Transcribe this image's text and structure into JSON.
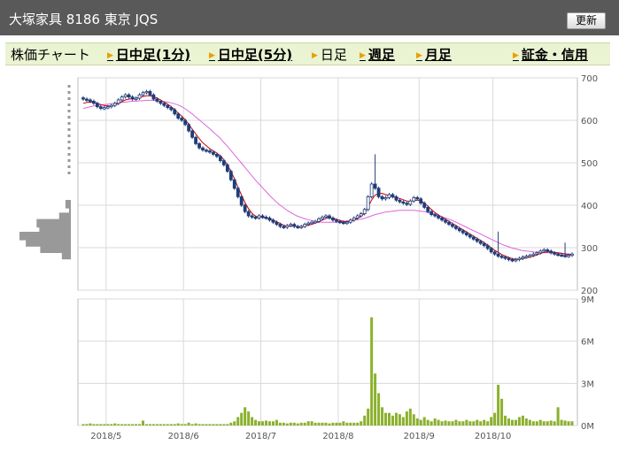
{
  "header": {
    "title": "大塚家具  8186  東京 JQS",
    "refresh_label": "更新"
  },
  "menu": {
    "items": [
      {
        "label": "株価チャート",
        "link": false,
        "arrow": false
      },
      {
        "label": "日中足(1分)",
        "link": true,
        "arrow": true
      },
      {
        "label": "日中足(5分)",
        "link": true,
        "arrow": true
      },
      {
        "label": "日足",
        "link": false,
        "arrow": true
      },
      {
        "label": "週足",
        "link": true,
        "arrow": true
      },
      {
        "label": "月足",
        "link": true,
        "arrow": true
      },
      {
        "label": "証金・信用",
        "link": true,
        "arrow": true
      }
    ]
  },
  "chart_data": [
    {
      "type": "candlestick",
      "title": "",
      "ylim": [
        200,
        700
      ],
      "yticks": [
        200,
        300,
        400,
        500,
        600,
        700
      ],
      "x_labels": [
        "2018/5",
        "2018/6",
        "2018/7",
        "2018/8",
        "2018/9",
        "2018/10"
      ],
      "grid": true,
      "colors": {
        "candle": "#1f3d7a",
        "ma_short": "#cc0000",
        "ma_long": "#dd66dd",
        "volume_profile": "#999999",
        "grid": "#d9d9d9"
      },
      "close_series": [
        650,
        648,
        645,
        640,
        632,
        628,
        630,
        632,
        635,
        640,
        648,
        655,
        660,
        655,
        650,
        652,
        660,
        665,
        668,
        660,
        650,
        645,
        640,
        635,
        630,
        625,
        615,
        605,
        600,
        590,
        575,
        560,
        545,
        535,
        530,
        528,
        525,
        520,
        515,
        505,
        495,
        480,
        460,
        440,
        420,
        400,
        385,
        375,
        372,
        370,
        375,
        372,
        370,
        365,
        360,
        355,
        350,
        348,
        352,
        355,
        350,
        348,
        350,
        355,
        358,
        360,
        362,
        368,
        372,
        375,
        370,
        365,
        362,
        360,
        358,
        360,
        365,
        370,
        375,
        380,
        390,
        420,
        450,
        440,
        420,
        415,
        418,
        425,
        420,
        412,
        408,
        405,
        402,
        410,
        418,
        415,
        405,
        395,
        385,
        378,
        375,
        370,
        365,
        360,
        355,
        350,
        345,
        340,
        335,
        330,
        325,
        320,
        315,
        310,
        305,
        298,
        290,
        285,
        280,
        278,
        275,
        272,
        270,
        272,
        275,
        278,
        280,
        282,
        285,
        288,
        292,
        295,
        292,
        288,
        285,
        283,
        282,
        280,
        282,
        285
      ],
      "ma_short": [
        640,
        642,
        643,
        642,
        640,
        637,
        635,
        634,
        634,
        636,
        639,
        644,
        648,
        650,
        651,
        652,
        654,
        656,
        658,
        658,
        656,
        652,
        648,
        643,
        638,
        632,
        625,
        617,
        610,
        601,
        591,
        579,
        568,
        557,
        547,
        540,
        533,
        528,
        523,
        516,
        507,
        495,
        480,
        462,
        443,
        424,
        406,
        392,
        381,
        374,
        372,
        371,
        370,
        368,
        365,
        361,
        357,
        353,
        351,
        351,
        351,
        350,
        350,
        351,
        353,
        355,
        358,
        361,
        365,
        369,
        370,
        369,
        367,
        364,
        362,
        361,
        362,
        365,
        369,
        374,
        381,
        396,
        412,
        424,
        428,
        428,
        425,
        422,
        420,
        418,
        416,
        413,
        410,
        409,
        411,
        412,
        410,
        405,
        398,
        390,
        383,
        377,
        372,
        367,
        362,
        357,
        352,
        347,
        342,
        337,
        332,
        327,
        322,
        317,
        312,
        306,
        300,
        294,
        289,
        284,
        280,
        277,
        274,
        273,
        273,
        274,
        276,
        278,
        280,
        283,
        286,
        289,
        290,
        290,
        289,
        288,
        287,
        285,
        284,
        284
      ],
      "ma_long": [
        628,
        630,
        632,
        634,
        635,
        636,
        637,
        638,
        639,
        640,
        641,
        642,
        643,
        644,
        645,
        645,
        646,
        646,
        647,
        647,
        647,
        646,
        645,
        644,
        643,
        641,
        639,
        636,
        632,
        627,
        621,
        615,
        608,
        601,
        594,
        587,
        580,
        572,
        565,
        557,
        548,
        539,
        529,
        519,
        509,
        499,
        489,
        479,
        469,
        459,
        450,
        441,
        432,
        423,
        415,
        407,
        400,
        394,
        388,
        383,
        378,
        374,
        371,
        368,
        366,
        364,
        362,
        361,
        360,
        360,
        360,
        360,
        360,
        361,
        362,
        363,
        364,
        365,
        366,
        367,
        369,
        372,
        375,
        378,
        380,
        382,
        384,
        385,
        386,
        387,
        388,
        388,
        388,
        388,
        388,
        387,
        386,
        385,
        383,
        381,
        379,
        376,
        373,
        370,
        367,
        364,
        360,
        356,
        352,
        348,
        344,
        340,
        336,
        332,
        328,
        324,
        320,
        316,
        312,
        308,
        305,
        302,
        299,
        297,
        295,
        293,
        292,
        291,
        290,
        289,
        289,
        288,
        288,
        288,
        287,
        287,
        286,
        286,
        285,
        285
      ],
      "spikes": [
        {
          "index": 83,
          "high": 520
        },
        {
          "index": 118,
          "high": 338
        },
        {
          "index": 137,
          "high": 312
        }
      ],
      "volume_profile": [
        6,
        2,
        13,
        38,
        35,
        57,
        50,
        34,
        10
      ]
    },
    {
      "type": "bar",
      "title": "",
      "ylim": [
        0,
        9
      ],
      "yticks": [
        0,
        3,
        6,
        9
      ],
      "ytick_labels": [
        "0M",
        "3M",
        "6M",
        "9M"
      ],
      "x_labels": [
        "2018/5",
        "2018/6",
        "2018/7",
        "2018/8",
        "2018/9",
        "2018/10"
      ],
      "grid": true,
      "colors": {
        "bar": "#8bb12d"
      },
      "values": [
        0.1,
        0.1,
        0.15,
        0.1,
        0.1,
        0.1,
        0.1,
        0.1,
        0.1,
        0.15,
        0.1,
        0.1,
        0.1,
        0.1,
        0.1,
        0.1,
        0.1,
        0.35,
        0.1,
        0.1,
        0.1,
        0.1,
        0.1,
        0.1,
        0.1,
        0.1,
        0.1,
        0.15,
        0.1,
        0.1,
        0.2,
        0.1,
        0.15,
        0.1,
        0.1,
        0.1,
        0.1,
        0.1,
        0.1,
        0.1,
        0.1,
        0.1,
        0.2,
        0.3,
        0.6,
        0.9,
        1.3,
        1.0,
        0.6,
        0.4,
        0.3,
        0.3,
        0.35,
        0.3,
        0.3,
        0.4,
        0.2,
        0.2,
        0.15,
        0.2,
        0.2,
        0.15,
        0.2,
        0.2,
        0.3,
        0.3,
        0.2,
        0.2,
        0.2,
        0.2,
        0.15,
        0.2,
        0.2,
        0.2,
        0.3,
        0.2,
        0.2,
        0.2,
        0.2,
        0.3,
        0.7,
        1.2,
        7.7,
        3.7,
        2.3,
        1.3,
        0.9,
        0.9,
        0.7,
        0.9,
        0.8,
        0.6,
        1.0,
        1.2,
        0.8,
        0.5,
        0.4,
        0.6,
        0.4,
        0.3,
        0.5,
        0.4,
        0.3,
        0.35,
        0.3,
        0.3,
        0.4,
        0.3,
        0.3,
        0.4,
        0.3,
        0.3,
        0.4,
        0.3,
        0.4,
        0.3,
        0.6,
        0.9,
        2.9,
        1.9,
        0.7,
        0.5,
        0.4,
        0.4,
        0.6,
        0.7,
        0.5,
        0.4,
        0.3,
        0.3,
        0.4,
        0.3,
        0.3,
        0.35,
        0.3,
        1.3,
        0.4,
        0.35,
        0.3,
        0.3
      ]
    }
  ]
}
